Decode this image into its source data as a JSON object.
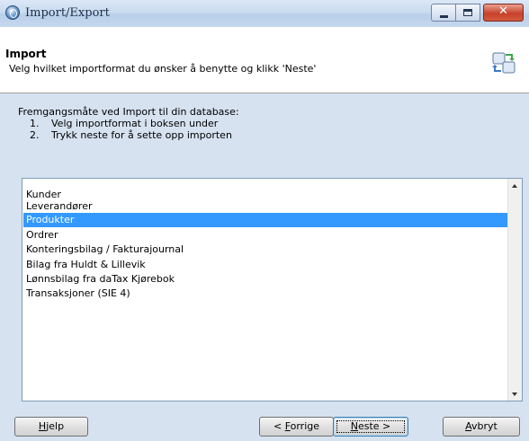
{
  "window": {
    "title": "Import/Export",
    "minimize_glyph": "",
    "maximize_glyph": "",
    "close_glyph": "✕"
  },
  "header": {
    "title": "Import",
    "subtitle": "Velg hvilket importformat du ønsker å benytte og klikk 'Neste'",
    "icon": "import-export-icon"
  },
  "instructions": {
    "title": "Fremgangsmåte ved Import til din database:",
    "steps": [
      {
        "num": "1.",
        "text": "Velg importformat i boksen under"
      },
      {
        "num": "2.",
        "text": "Trykk neste for å sette opp importen"
      }
    ]
  },
  "list": {
    "items": [
      "Kunder",
      "Leverandører",
      "Produkter",
      "Ordrer",
      "Konteringsbilag / Fakturajournal",
      "Bilag fra Huldt & Lillevik",
      "Lønnsbilag fra daTax Kjørebok",
      "Transaksjoner (SIE 4)"
    ],
    "selected_index": 2
  },
  "buttons": {
    "help": {
      "prefix": "",
      "accel": "H",
      "rest": "jelp"
    },
    "prev": {
      "prefix": "< ",
      "accel": "F",
      "rest": "orrige"
    },
    "next": {
      "prefix": "",
      "accel": "N",
      "rest": "este >"
    },
    "cancel": {
      "prefix": "",
      "accel": "A",
      "rest": "vbryt"
    }
  },
  "colors": {
    "selection": "#3399ff",
    "panel": "#d6e2f0",
    "close_button": "#c7422a"
  }
}
